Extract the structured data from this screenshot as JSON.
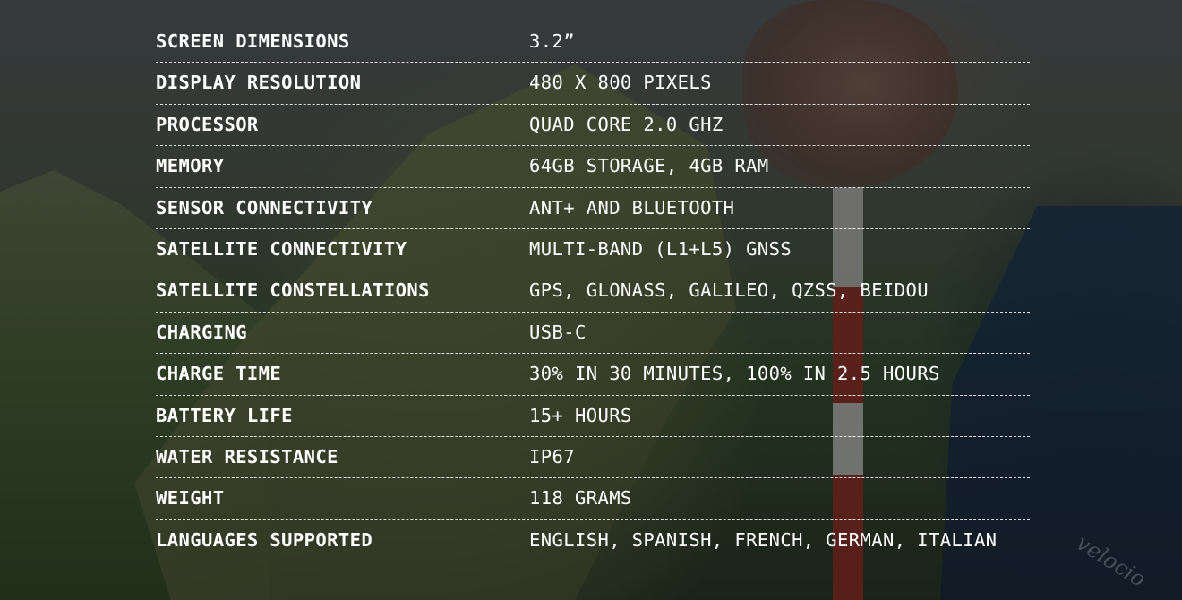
{
  "specs": [
    {
      "label": "SCREEN DIMENSIONS",
      "value": "3.2”"
    },
    {
      "label": "DISPLAY RESOLUTION",
      "value": "480 X 800 PIXELS"
    },
    {
      "label": "PROCESSOR",
      "value": "QUAD CORE 2.0 GHZ"
    },
    {
      "label": "MEMORY",
      "value": "64GB STORAGE, 4GB RAM"
    },
    {
      "label": "SENSOR CONNECTIVITY",
      "value": "ANT+ AND BLUETOOTH"
    },
    {
      "label": "SATELLITE CONNECTIVITY",
      "value": "MULTI-BAND (L1+L5) GNSS"
    },
    {
      "label": "SATELLITE CONSTELLATIONS",
      "value": "GPS, GLONASS, GALILEO, QZSS, BEIDOU"
    },
    {
      "label": "CHARGING",
      "value": "USB-C"
    },
    {
      "label": "CHARGE TIME",
      "value": "30% IN 30 MINUTES, 100% IN 2.5 HOURS"
    },
    {
      "label": "BATTERY LIFE",
      "value": "15+ HOURS"
    },
    {
      "label": "WATER RESISTANCE",
      "value": "IP67"
    },
    {
      "label": "WEIGHT",
      "value": "118 GRAMS"
    },
    {
      "label": "LANGUAGES SUPPORTED",
      "value": "ENGLISH, SPANISH, FRENCH, GERMAN, ITALIAN"
    }
  ],
  "watermark": "velocio",
  "colors": {
    "text": "#ffffff",
    "divider": "#ffffff",
    "overlay": "#000000"
  }
}
